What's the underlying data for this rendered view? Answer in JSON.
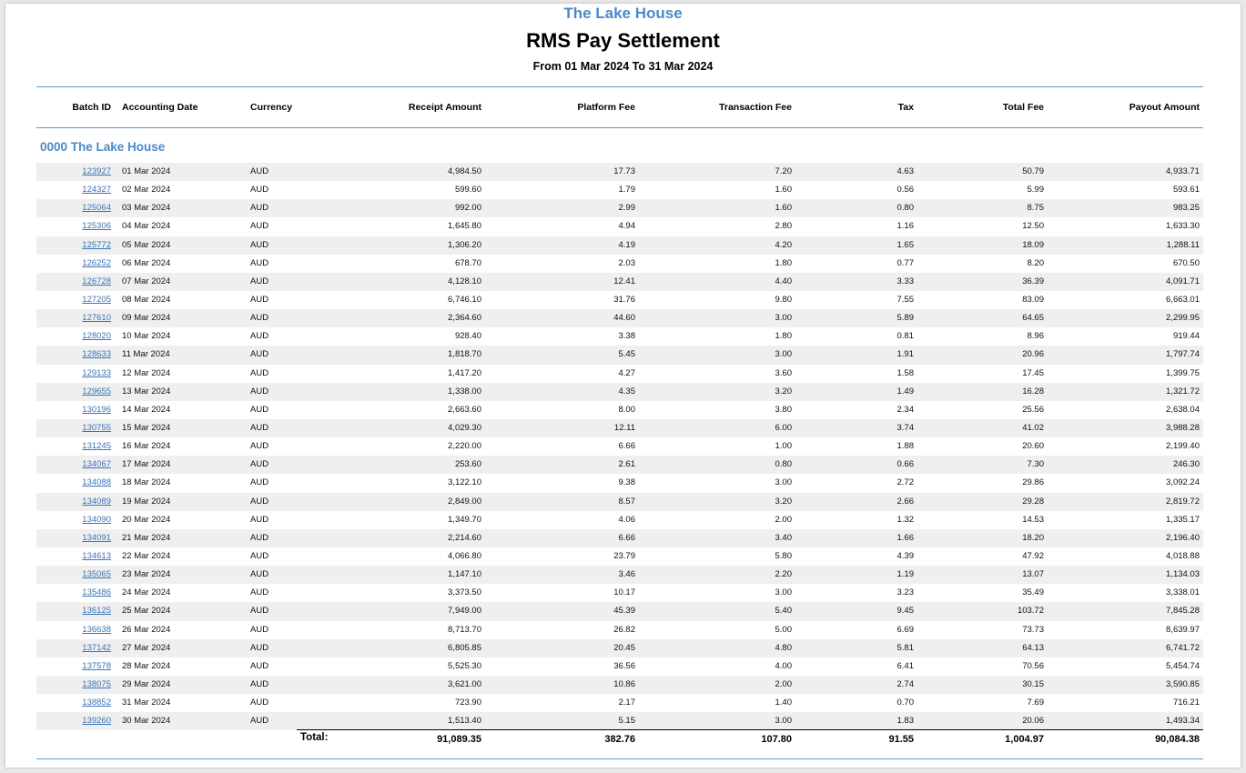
{
  "report": {
    "property_name": "The Lake House",
    "title": "RMS Pay Settlement",
    "date_range": "From 01 Mar 2024 To 31 Mar 2024"
  },
  "colors": {
    "accent_blue": "#4a89c8",
    "rule_blue": "#5d98cf",
    "link_blue": "#3a73b5",
    "row_shade": "#efefef"
  },
  "table": {
    "headers": {
      "batch_id": "Batch ID",
      "accounting_date": "Accounting Date",
      "currency": "Currency",
      "receipt_amount": "Receipt Amount",
      "platform_fee": "Platform Fee",
      "transaction_fee": "Transaction Fee",
      "tax": "Tax",
      "total_fee": "Total Fee",
      "payout_amount": "Payout Amount"
    },
    "group_title": "0000 The Lake House",
    "rows": [
      [
        "123927",
        "01 Mar 2024",
        "AUD",
        "4,984.50",
        "17.73",
        "7.20",
        "4.63",
        "50.79",
        "4,933.71"
      ],
      [
        "124327",
        "02 Mar 2024",
        "AUD",
        "599.60",
        "1.79",
        "1.60",
        "0.56",
        "5.99",
        "593.61"
      ],
      [
        "125064",
        "03 Mar 2024",
        "AUD",
        "992.00",
        "2.99",
        "1.60",
        "0.80",
        "8.75",
        "983.25"
      ],
      [
        "125306",
        "04 Mar 2024",
        "AUD",
        "1,645.80",
        "4.94",
        "2.80",
        "1.16",
        "12.50",
        "1,633.30"
      ],
      [
        "125772",
        "05 Mar 2024",
        "AUD",
        "1,306.20",
        "4.19",
        "4.20",
        "1.65",
        "18.09",
        "1,288.11"
      ],
      [
        "126252",
        "06 Mar 2024",
        "AUD",
        "678.70",
        "2.03",
        "1.80",
        "0.77",
        "8.20",
        "670.50"
      ],
      [
        "126728",
        "07 Mar 2024",
        "AUD",
        "4,128.10",
        "12.41",
        "4.40",
        "3.33",
        "36.39",
        "4,091.71"
      ],
      [
        "127205",
        "08 Mar 2024",
        "AUD",
        "6,746.10",
        "31.76",
        "9.80",
        "7.55",
        "83.09",
        "6,663.01"
      ],
      [
        "127610",
        "09 Mar 2024",
        "AUD",
        "2,364.60",
        "44.60",
        "3.00",
        "5.89",
        "64.65",
        "2,299.95"
      ],
      [
        "128020",
        "10 Mar 2024",
        "AUD",
        "928.40",
        "3.38",
        "1.80",
        "0.81",
        "8.96",
        "919.44"
      ],
      [
        "128633",
        "11 Mar 2024",
        "AUD",
        "1,818.70",
        "5.45",
        "3.00",
        "1.91",
        "20.96",
        "1,797.74"
      ],
      [
        "129133",
        "12 Mar 2024",
        "AUD",
        "1,417.20",
        "4.27",
        "3.60",
        "1.58",
        "17.45",
        "1,399.75"
      ],
      [
        "129655",
        "13 Mar 2024",
        "AUD",
        "1,338.00",
        "4.35",
        "3.20",
        "1.49",
        "16.28",
        "1,321.72"
      ],
      [
        "130196",
        "14 Mar 2024",
        "AUD",
        "2,663.60",
        "8.00",
        "3.80",
        "2.34",
        "25.56",
        "2,638.04"
      ],
      [
        "130755",
        "15 Mar 2024",
        "AUD",
        "4,029.30",
        "12.11",
        "6.00",
        "3.74",
        "41.02",
        "3,988.28"
      ],
      [
        "131245",
        "16 Mar 2024",
        "AUD",
        "2,220.00",
        "6.66",
        "1.00",
        "1.88",
        "20.60",
        "2,199.40"
      ],
      [
        "134067",
        "17 Mar 2024",
        "AUD",
        "253.60",
        "2.61",
        "0.80",
        "0.66",
        "7.30",
        "246.30"
      ],
      [
        "134088",
        "18 Mar 2024",
        "AUD",
        "3,122.10",
        "9.38",
        "3.00",
        "2.72",
        "29.86",
        "3,092.24"
      ],
      [
        "134089",
        "19 Mar 2024",
        "AUD",
        "2,849.00",
        "8.57",
        "3.20",
        "2.66",
        "29.28",
        "2,819.72"
      ],
      [
        "134090",
        "20 Mar 2024",
        "AUD",
        "1,349.70",
        "4.06",
        "2.00",
        "1.32",
        "14.53",
        "1,335.17"
      ],
      [
        "134091",
        "21 Mar 2024",
        "AUD",
        "2,214.60",
        "6.66",
        "3.40",
        "1.66",
        "18.20",
        "2,196.40"
      ],
      [
        "134613",
        "22 Mar 2024",
        "AUD",
        "4,066.80",
        "23.79",
        "5.80",
        "4.39",
        "47.92",
        "4,018.88"
      ],
      [
        "135065",
        "23 Mar 2024",
        "AUD",
        "1,147.10",
        "3.46",
        "2.20",
        "1.19",
        "13.07",
        "1,134.03"
      ],
      [
        "135486",
        "24 Mar 2024",
        "AUD",
        "3,373.50",
        "10.17",
        "3.00",
        "3.23",
        "35.49",
        "3,338.01"
      ],
      [
        "136125",
        "25 Mar 2024",
        "AUD",
        "7,949.00",
        "45.39",
        "5.40",
        "9.45",
        "103.72",
        "7,845.28"
      ],
      [
        "136638",
        "26 Mar 2024",
        "AUD",
        "8,713.70",
        "26.82",
        "5.00",
        "6.69",
        "73.73",
        "8,639.97"
      ],
      [
        "137142",
        "27 Mar 2024",
        "AUD",
        "6,805.85",
        "20.45",
        "4.80",
        "5.81",
        "64.13",
        "6,741.72"
      ],
      [
        "137578",
        "28 Mar 2024",
        "AUD",
        "5,525.30",
        "36.56",
        "4.00",
        "6.41",
        "70.56",
        "5,454.74"
      ],
      [
        "138075",
        "29 Mar 2024",
        "AUD",
        "3,621.00",
        "10.86",
        "2.00",
        "2.74",
        "30.15",
        "3,590.85"
      ],
      [
        "138852",
        "31 Mar 2024",
        "AUD",
        "723.90",
        "2.17",
        "1.40",
        "0.70",
        "7.69",
        "716.21"
      ],
      [
        "139260",
        "30 Mar 2024",
        "AUD",
        "1,513.40",
        "5.15",
        "3.00",
        "1.83",
        "20.06",
        "1,493.34"
      ]
    ],
    "totals": {
      "label": "Total:",
      "receipt_amount": "91,089.35",
      "platform_fee": "382.76",
      "transaction_fee": "107.80",
      "tax": "91.55",
      "total_fee": "1,004.97",
      "payout_amount": "90,084.38"
    }
  }
}
